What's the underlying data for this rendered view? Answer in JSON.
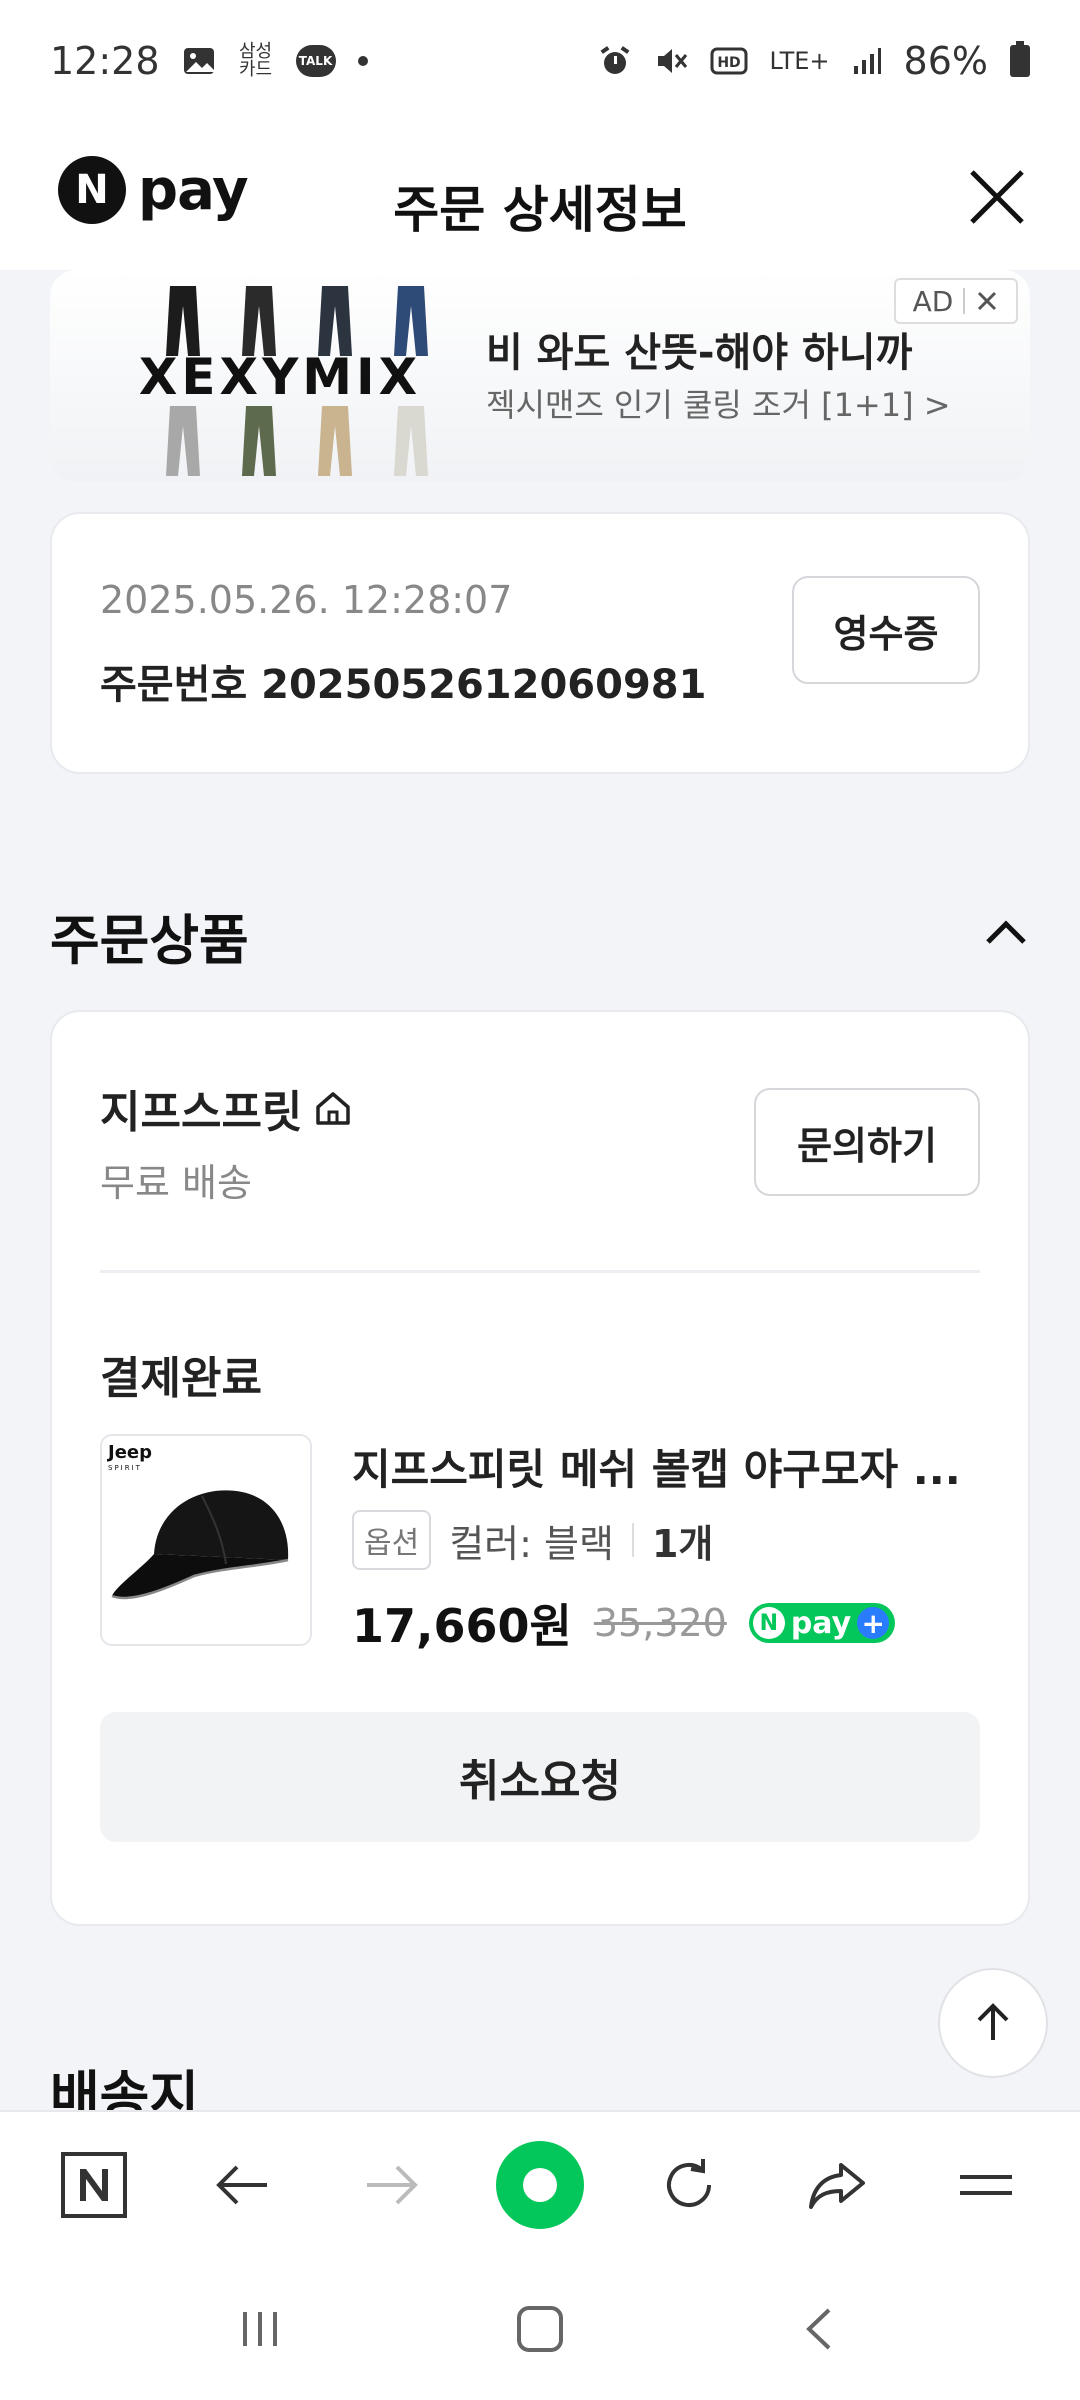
{
  "status_bar": {
    "time": "12:28",
    "samsung_card": "삼성\n카드",
    "talk_label": "TALK",
    "network": "LTE+",
    "battery": "86%"
  },
  "header": {
    "logo_n": "N",
    "logo_text": "pay",
    "title": "주문 상세정보"
  },
  "ad": {
    "brand": "XEXYMIX",
    "headline": "비 와도 산뜻-해야 하니까",
    "subtext": "젝시맨즈 인기 쿨링 조거 [1+1] >",
    "badge": "AD"
  },
  "order": {
    "datetime": "2025.05.26. 12:28:07",
    "order_number": "주문번호 2025052612060981",
    "receipt_button": "영수증"
  },
  "section": {
    "title": "주문상품",
    "next_title": "배송지"
  },
  "seller": {
    "name": "지프스프릿",
    "shipping": "무료 배송",
    "inquiry_button": "문의하기"
  },
  "item": {
    "status": "결제완료",
    "title": "지프스피릿 메쉬 볼캡 야구모자 ...",
    "option_tag": "옵션",
    "option_value": "컬러: 블랙",
    "quantity": "1개",
    "price": "17,660원",
    "original_price": "35,320",
    "npay_label": "pay",
    "thumb_brand": "Jeep",
    "thumb_sub": "SPIRIT",
    "cancel_button": "취소요청"
  },
  "colors": {
    "npay_green": "#03c75a",
    "plus_blue": "#2a7cff"
  }
}
